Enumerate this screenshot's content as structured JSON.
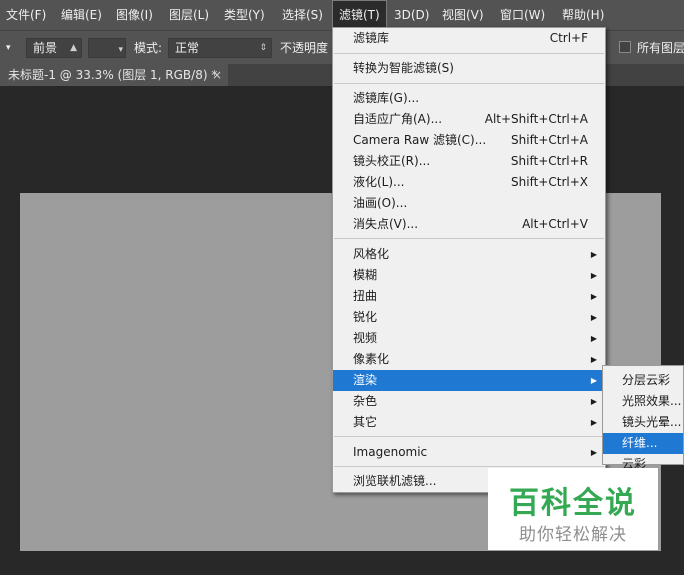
{
  "menubar": {
    "items": [
      "文件(F)",
      "编辑(E)",
      "图像(I)",
      "图层(L)",
      "类型(Y)",
      "选择(S)",
      "滤镜(T)",
      "3D(D)",
      "视图(V)",
      "窗口(W)",
      "帮助(H)"
    ]
  },
  "options": {
    "preset": "前景",
    "mode_label": "模式:",
    "mode_value": "正常",
    "opacity_label": "不透明度",
    "all_layers_label": "所有图层"
  },
  "document": {
    "tab_title": "未标题-1 @ 33.3% (图层 1, RGB/8) *",
    "close_glyph": "×"
  },
  "menu": {
    "items": [
      {
        "label": "滤镜库",
        "shortcut": "Ctrl+F"
      },
      {
        "label": "转换为智能滤镜(S)",
        "shortcut": ""
      },
      {
        "label": "滤镜库(G)...",
        "shortcut": ""
      },
      {
        "label": "自适应广角(A)...",
        "shortcut": "Alt+Shift+Ctrl+A"
      },
      {
        "label": "Camera Raw 滤镜(C)...",
        "shortcut": "Shift+Ctrl+A"
      },
      {
        "label": "镜头校正(R)...",
        "shortcut": "Shift+Ctrl+R"
      },
      {
        "label": "液化(L)...",
        "shortcut": "Shift+Ctrl+X"
      },
      {
        "label": "油画(O)...",
        "shortcut": ""
      },
      {
        "label": "消失点(V)...",
        "shortcut": "Alt+Ctrl+V"
      },
      {
        "label": "风格化",
        "shortcut": ""
      },
      {
        "label": "模糊",
        "shortcut": ""
      },
      {
        "label": "扭曲",
        "shortcut": ""
      },
      {
        "label": "锐化",
        "shortcut": ""
      },
      {
        "label": "视频",
        "shortcut": ""
      },
      {
        "label": "像素化",
        "shortcut": ""
      },
      {
        "label": "渲染",
        "shortcut": ""
      },
      {
        "label": "杂色",
        "shortcut": ""
      },
      {
        "label": "其它",
        "shortcut": ""
      },
      {
        "label": "Imagenomic",
        "shortcut": ""
      },
      {
        "label": "浏览联机滤镜...",
        "shortcut": ""
      }
    ]
  },
  "submenu": {
    "items": [
      "分层云彩",
      "光照效果...",
      "镜头光晕...",
      "纤维...",
      "云彩"
    ]
  },
  "watermark": {
    "title": "百科全说",
    "subtitle": "助你轻松解决"
  },
  "colors": {
    "menubar_bg": "#535353",
    "menu_bg": "#f0f0f0",
    "highlight": "#1f78d2",
    "canvas": "#9d9d9d",
    "watermark_green": "#34a853"
  }
}
